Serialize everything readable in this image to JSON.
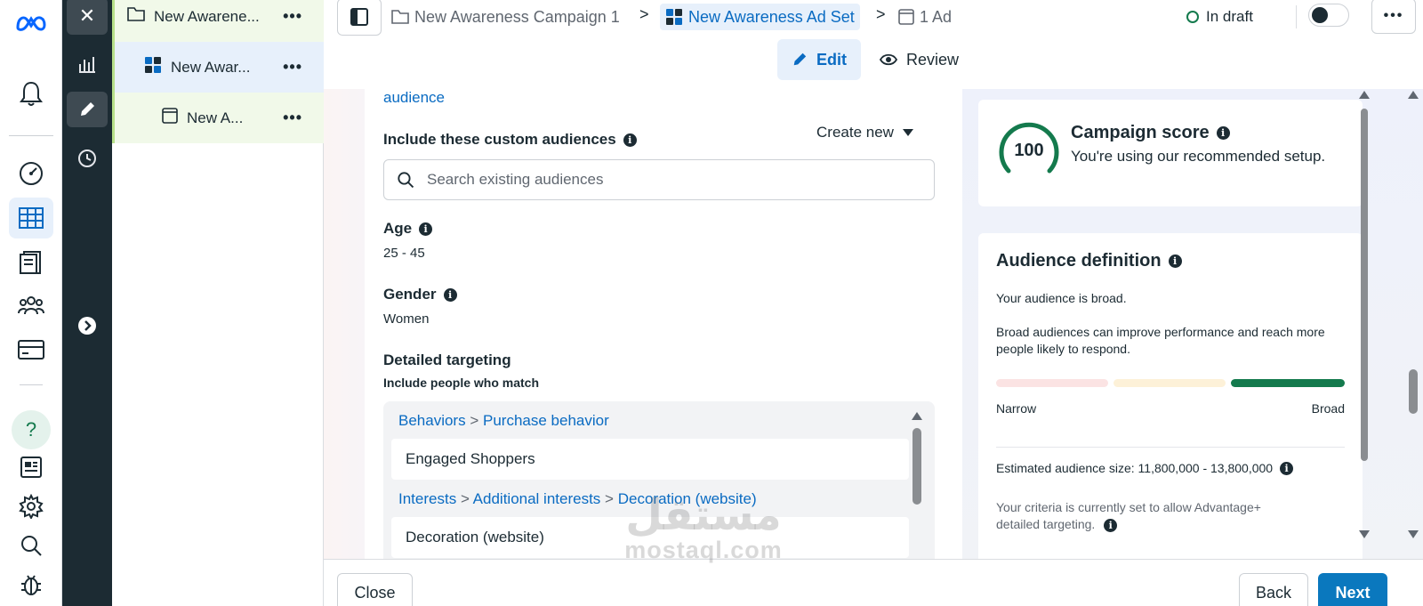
{
  "rail": {
    "logo": "meta-logo-icon",
    "icons": [
      "bell-icon",
      "speedometer-icon",
      "table-icon",
      "pages-icon",
      "audience-icon",
      "billing-icon",
      "help-icon",
      "news-icon",
      "settings-icon",
      "search-icon",
      "bug-icon"
    ],
    "help_glyph": "?"
  },
  "toolcol": {
    "close_glyph": "✕"
  },
  "tree": {
    "campaign": "New Awarene...",
    "adset": "New Awar...",
    "ad": "New A...",
    "dots": "•••"
  },
  "breadcrumbs": {
    "campaign": "New Awareness Campaign 1",
    "adset": "New Awareness Ad Set",
    "ad": "1 Ad",
    "sep": ">"
  },
  "status": {
    "label": "In draft",
    "color": "#147a4d"
  },
  "more": "•••",
  "tabs": {
    "edit": "Edit",
    "review": "Review"
  },
  "form": {
    "audience_link": "audience",
    "custom_audiences_label": "Include these custom audiences",
    "create_new": "Create new",
    "search_placeholder": "Search existing audiences",
    "age_label": "Age",
    "age_value": "25 - 45",
    "gender_label": "Gender",
    "gender_value": "Women",
    "detailed_label": "Detailed targeting",
    "detailed_sub": "Include people who match",
    "targeting": [
      {
        "path": [
          "Behaviors",
          "Purchase behavior"
        ],
        "item": "Engaged Shoppers"
      },
      {
        "path": [
          "Interests",
          "Additional interests",
          "Decoration (website)"
        ],
        "item": "Decoration (website)"
      }
    ]
  },
  "score": {
    "value": "100",
    "title": "Campaign score",
    "subtitle": "You're using our recommended setup.",
    "ring_color": "#147a4d"
  },
  "audience_def": {
    "title": "Audience definition",
    "broad_line": "Your audience is broad.",
    "desc": "Broad audiences can improve performance and reach more people likely to respond.",
    "narrow": "Narrow",
    "broad": "Broad",
    "size": "Estimated audience size: 11,800,000 - 13,800,000",
    "criteria": "Your criteria is currently set to allow Advantage+ detailed targeting.",
    "meter_colors": [
      "#fbe3e3",
      "#fdf1d8",
      "#147a4d"
    ],
    "meter_level": "Broad"
  },
  "footer": {
    "close": "Close",
    "back": "Back",
    "next": "Next"
  },
  "watermark": {
    "arabic": "مستقل",
    "latin": "mostaql.com"
  },
  "colors": {
    "accent": "#0a6bc2",
    "primary_button": "#0a78be",
    "dark_rail": "#1c2b33"
  }
}
